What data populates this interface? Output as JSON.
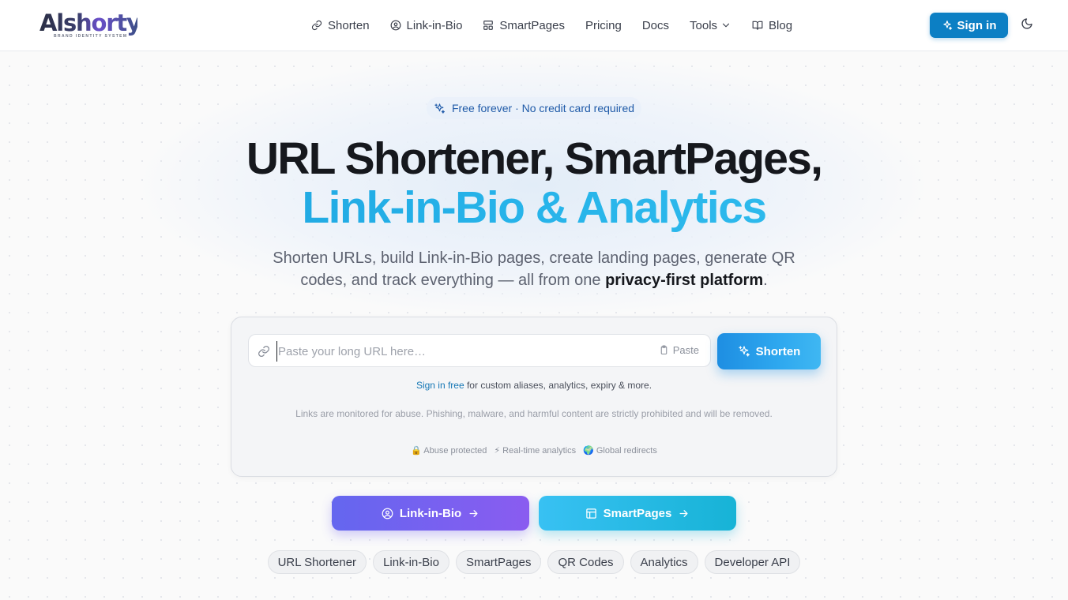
{
  "brand": {
    "logo_text": "Alshorty",
    "logo_subtitle": "BRAND IDENTITY SYSTEM",
    "accent": "#0c7fc4"
  },
  "nav": {
    "items": [
      {
        "label": "Shorten",
        "icon": "link-icon"
      },
      {
        "label": "Link-in-Bio",
        "icon": "user-circle-icon"
      },
      {
        "label": "SmartPages",
        "icon": "layout-icon"
      },
      {
        "label": "Pricing",
        "icon": ""
      },
      {
        "label": "Docs",
        "icon": ""
      },
      {
        "label": "Tools",
        "icon": "chevron-down-icon"
      },
      {
        "label": "Blog",
        "icon": "book-icon"
      }
    ],
    "signin_label": "Sign in",
    "theme_toggle_icon": "moon-icon"
  },
  "hero": {
    "badge": "Free forever · No credit card required",
    "title_line1": "URL Shortener, SmartPages,",
    "title_line2": "Link-in-Bio & Analytics",
    "lede_prefix": "Shorten URLs, build Link-in-Bio pages, create landing pages, generate QR codes, and track everything — all from one ",
    "lede_bold": "privacy-first platform",
    "lede_suffix": "."
  },
  "shortener": {
    "placeholder": "Paste your long URL here…",
    "value": "",
    "paste_label": "Paste",
    "button_label": "Shorten",
    "signin_link": "Sign in free",
    "signin_note": " for custom aliases, analytics, expiry & more.",
    "abuse_note": "Links are monitored for abuse. Phishing, malware, and harmful content are strictly prohibited and will be removed.",
    "features": [
      "🔒 Abuse protected",
      "⚡ Real-time analytics",
      "🌍 Global redirects"
    ]
  },
  "cta": {
    "link_in_bio": "Link-in-Bio",
    "smartpages": "SmartPages"
  },
  "pills": [
    "URL Shortener",
    "Link-in-Bio",
    "SmartPages",
    "QR Codes",
    "Analytics",
    "Developer API"
  ]
}
